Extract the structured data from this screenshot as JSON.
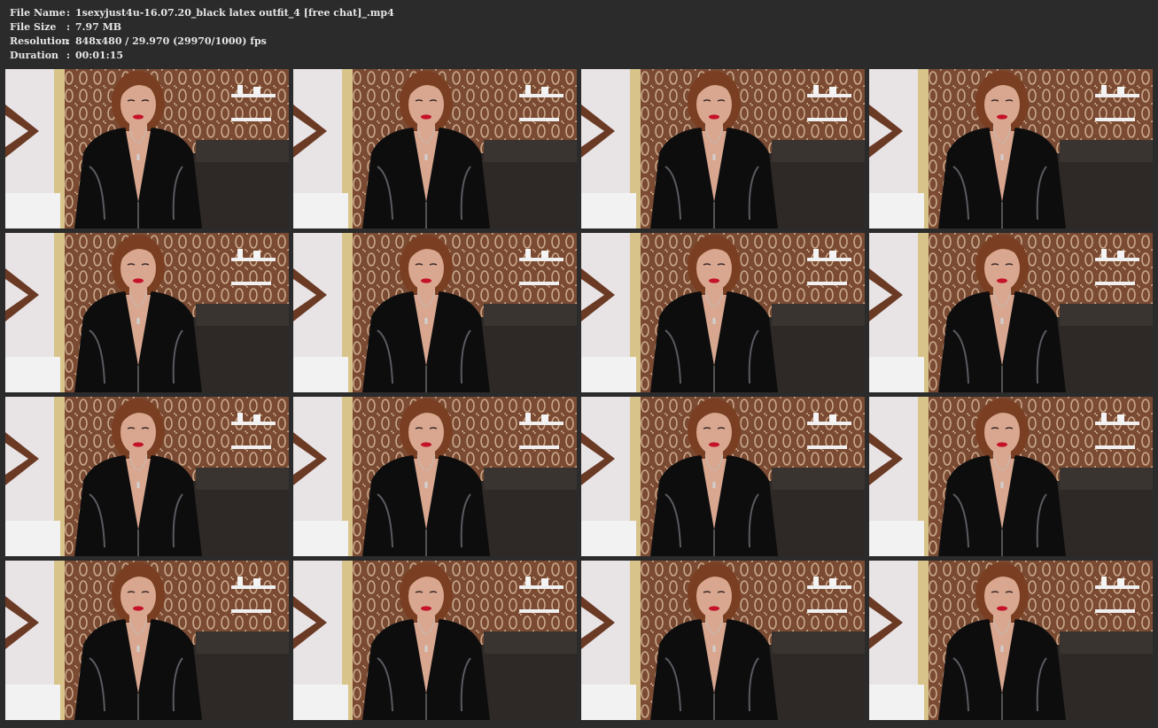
{
  "file_info": {
    "rows": [
      {
        "label": "File Name",
        "sep": ":",
        "value": "1sexyjust4u-16.07.20_black latex outfit_4 [free chat]_.mp4"
      },
      {
        "label": "File Size",
        "sep": ":",
        "value": "7.97 MB"
      },
      {
        "label": "Resolution",
        "sep": ":",
        "value": "848x480 / 29.970 (29970/1000) fps"
      },
      {
        "label": "Duration",
        "sep": ":",
        "value": "00:01:15"
      }
    ]
  },
  "thumbnail_grid": {
    "rows": 4,
    "columns": 4,
    "frames": [
      {
        "icon": "video-frame-thumbnail",
        "head_offset": 0.0
      },
      {
        "icon": "video-frame-thumbnail",
        "head_offset": 0.0
      },
      {
        "icon": "video-frame-thumbnail",
        "head_offset": 0.0
      },
      {
        "icon": "video-frame-thumbnail",
        "head_offset": 0.0
      },
      {
        "icon": "video-frame-thumbnail",
        "head_offset": 0.0
      },
      {
        "icon": "video-frame-thumbnail",
        "head_offset": 0.0
      },
      {
        "icon": "video-frame-thumbnail",
        "head_offset": 0.0
      },
      {
        "icon": "video-frame-thumbnail",
        "head_offset": 0.0
      },
      {
        "icon": "video-frame-thumbnail",
        "head_offset": 0.0
      },
      {
        "icon": "video-frame-thumbnail",
        "head_offset": 0.0
      },
      {
        "icon": "video-frame-thumbnail",
        "head_offset": 0.0
      },
      {
        "icon": "video-frame-thumbnail",
        "head_offset": 0.0
      },
      {
        "icon": "video-frame-thumbnail",
        "head_offset": 0.0
      },
      {
        "icon": "video-frame-thumbnail",
        "head_offset": 0.0
      },
      {
        "icon": "video-frame-thumbnail",
        "head_offset": 0.0
      },
      {
        "icon": "video-frame-thumbnail",
        "head_offset": 0.0
      }
    ]
  },
  "colors": {
    "background": "#2b2b2b",
    "text": "#e6e6e6",
    "wallpaper": "#7a4a33",
    "wallpaper_pattern": "#c9a88a",
    "wall_white": "#e8e4e6",
    "sofa": "#2e2926",
    "outfit": "#0d0d0e",
    "skin": "#d9a78f",
    "hair": "#7a3f22",
    "lips": "#c4122a"
  }
}
